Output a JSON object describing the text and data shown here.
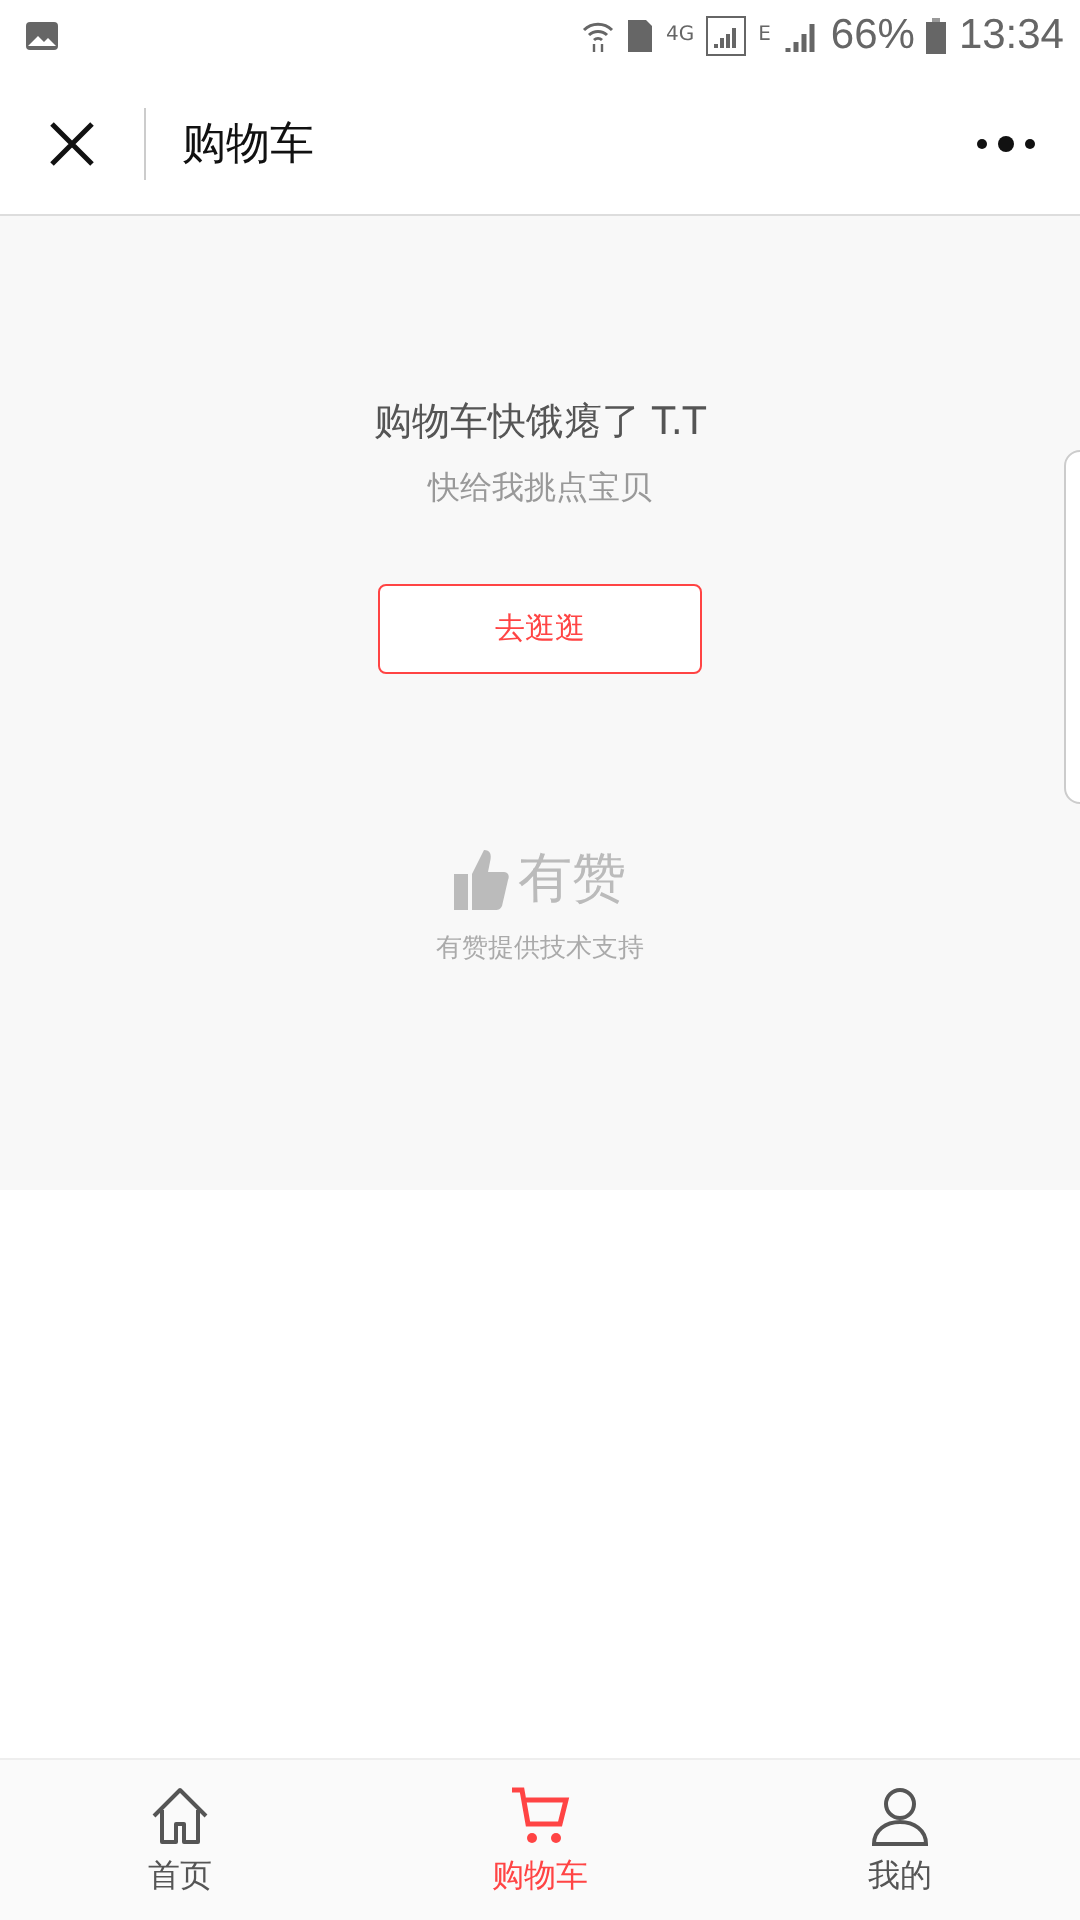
{
  "status_bar": {
    "network": "4G",
    "network2": "E",
    "battery": "66%",
    "time": "13:34"
  },
  "nav": {
    "title": "购物车"
  },
  "empty": {
    "title": "购物车快饿瘪了 T.T",
    "subtitle": "快给我挑点宝贝",
    "button": "去逛逛"
  },
  "brand": {
    "name": "有赞",
    "support": "有赞提供技术支持"
  },
  "tabs": [
    {
      "label": "首页",
      "kind": "home",
      "selected": false
    },
    {
      "label": "购物车",
      "kind": "cart",
      "selected": true
    },
    {
      "label": "我的",
      "kind": "user",
      "selected": false
    }
  ]
}
